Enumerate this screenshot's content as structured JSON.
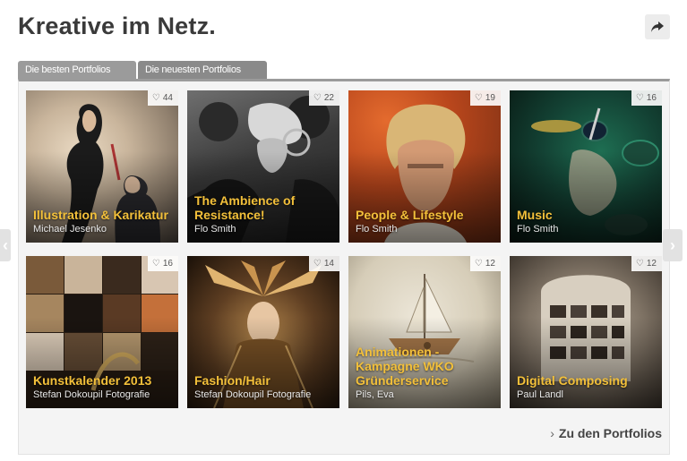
{
  "page": {
    "title": "Kreative im Netz."
  },
  "share": {
    "icon": "share-icon"
  },
  "tabs": [
    {
      "label": "Die besten Portfolios",
      "active": true
    },
    {
      "label": "Die neuesten Portfolios",
      "active": false
    }
  ],
  "tiles": [
    {
      "title": "Illustration & Karikatur",
      "author": "Michael Jesenko",
      "likes": "44"
    },
    {
      "title": "The Ambience of Resistance!",
      "author": "Flo Smith",
      "likes": "22"
    },
    {
      "title": "People & Lifestyle",
      "author": "Flo Smith",
      "likes": "19"
    },
    {
      "title": "Music",
      "author": "Flo Smith",
      "likes": "16"
    },
    {
      "title": "Kunstkalender 2013",
      "author": "Stefan Dokoupil Fotografie",
      "likes": "16"
    },
    {
      "title": "Fashion/Hair",
      "author": "Stefan Dokoupil Fotografie",
      "likes": "14"
    },
    {
      "title": "Animationen - Kampagne WKO Gründerservice",
      "author": "Pils, Eva",
      "likes": "12"
    },
    {
      "title": "Digital Composing",
      "author": "Paul Landl",
      "likes": "12"
    }
  ],
  "footer": {
    "more_label": "Zu den Portfolios"
  },
  "colors": {
    "accent": "#f3c03a",
    "tab": "#9b9b9b"
  }
}
